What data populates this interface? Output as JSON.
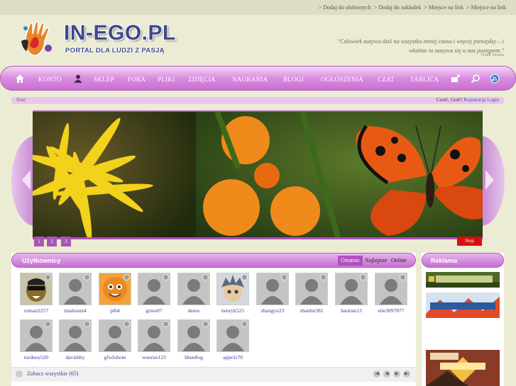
{
  "top_links": [
    "> Dodaj do ulubionych",
    "> Dodaj do zakładek",
    "> Miejsce na link",
    "> Miejsce na link"
  ],
  "logo": {
    "title": "IN-EGO.PL",
    "subtitle": "PORTAL DLA LUDZI Z PASJĄ"
  },
  "quote": {
    "text": "\"Człowiek zużywa dziś na wszystko mniej czasu i więcej pieniędzy – i właśnie to nazywa się u nas postępem.\"",
    "author": "Frank Sinatra"
  },
  "nav": [
    "KONTO",
    "SKLEP",
    "FORA",
    "PLIKI",
    "ZDJĘCIA",
    "NAGRANIA",
    "BLOGI",
    "OGŁOSZENIA",
    "CZAT",
    "TABLICA"
  ],
  "breadcrumb": {
    "home": "Start",
    "greeting": "Cześć, Gość!",
    "links": "Rejestracja Login"
  },
  "slider": {
    "pages": [
      "1",
      "2",
      "3"
    ],
    "stop_label": "Stop"
  },
  "users_panel": {
    "title": "Użytkownicy",
    "tabs": [
      "Ostatnie",
      "Najlepsze",
      "Online"
    ],
    "users": [
      "roman2257",
      "marksoni4",
      "pl64",
      "grzes07",
      "demo",
      "henryk525",
      "zhangyu23",
      "zhanlin381",
      "haotian13",
      "tele3097877",
      "turdney520",
      "davisbhy",
      "gfwfuhom",
      "wenruo123",
      "hhen8og",
      "appe1r70"
    ],
    "see_all": "Zobacz wszystkie (65)"
  },
  "ads_panel": {
    "title": "Reklama"
  },
  "colors": {
    "accent": "#c46ed0",
    "link": "#3b3b9c",
    "stop": "#d80e0e"
  }
}
